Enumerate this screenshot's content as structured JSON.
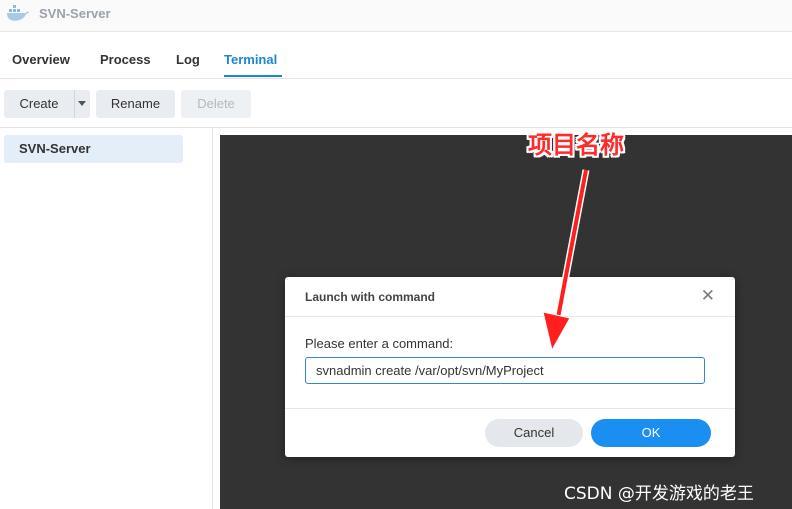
{
  "window": {
    "title": "SVN-Server",
    "icon": "docker-whale-icon"
  },
  "tabs": [
    {
      "label": "Overview",
      "active": false
    },
    {
      "label": "Process",
      "active": false
    },
    {
      "label": "Log",
      "active": false
    },
    {
      "label": "Terminal",
      "active": true
    }
  ],
  "toolbar": {
    "create_label": "Create",
    "rename_label": "Rename",
    "delete_label": "Delete"
  },
  "sidebar": {
    "items": [
      {
        "label": "SVN-Server",
        "selected": true
      }
    ]
  },
  "dialog": {
    "title": "Launch with command",
    "prompt": "Please enter a command:",
    "command_value": "svnadmin create /var/opt/svn/MyProject",
    "cancel_label": "Cancel",
    "ok_label": "OK"
  },
  "annotation": {
    "text": "项目名称",
    "color": "#ff2a2a"
  },
  "watermark": "CSDN @开发游戏的老王",
  "colors": {
    "accent": "#1a86d6",
    "ok_button": "#1b8ef2",
    "terminal_bg": "#333333"
  }
}
